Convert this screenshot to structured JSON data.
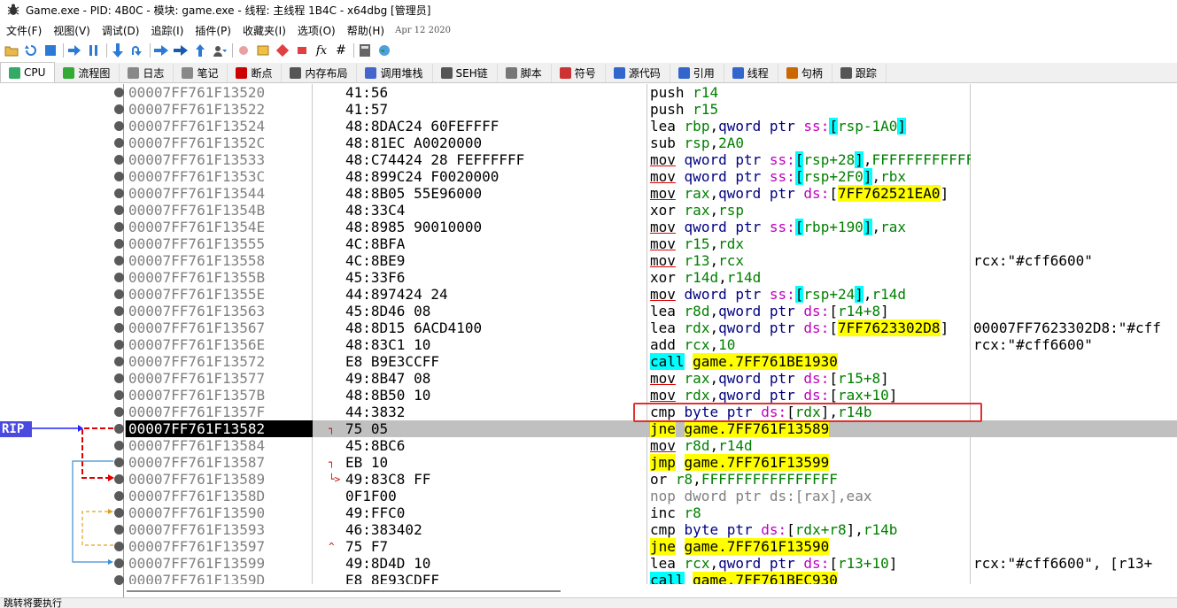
{
  "window": {
    "title": "Game.exe - PID: 4B0C - 模块: game.exe - 线程: 主线程 1B4C - x64dbg [管理员]",
    "app_icon": "x64dbg-bug-icon"
  },
  "menu": {
    "items": [
      "文件(F)",
      "视图(V)",
      "调试(D)",
      "追踪(I)",
      "插件(P)",
      "收藏夹(I)",
      "选项(O)",
      "帮助(H)"
    ],
    "date": "Apr 12 2020"
  },
  "toolbar": {
    "icons": [
      "open-icon",
      "restart-icon",
      "stop-icon",
      "run-icon",
      "pause-icon",
      "step-into-icon",
      "step-over-icon",
      "trace-into-icon",
      "trace-over-icon",
      "execute-till-return-icon",
      "run-to-user-code-icon",
      "scylla-icon",
      "patches-icon",
      "comments-icon",
      "labels-icon",
      "bookmarks-icon",
      "functions-icon",
      "variables-icon",
      "calculator-icon",
      "globe-icon"
    ]
  },
  "tabs": [
    {
      "label": "CPU",
      "icon": "cpu-icon",
      "active": true
    },
    {
      "label": "流程图",
      "icon": "graph-icon"
    },
    {
      "label": "日志",
      "icon": "log-icon"
    },
    {
      "label": "笔记",
      "icon": "notes-icon"
    },
    {
      "label": "断点",
      "icon": "breakpoint-icon"
    },
    {
      "label": "内存布局",
      "icon": "memory-icon"
    },
    {
      "label": "调用堆栈",
      "icon": "callstack-icon"
    },
    {
      "label": "SEH链",
      "icon": "seh-icon"
    },
    {
      "label": "脚本",
      "icon": "script-icon"
    },
    {
      "label": "符号",
      "icon": "symbols-icon"
    },
    {
      "label": "源代码",
      "icon": "source-icon"
    },
    {
      "label": "引用",
      "icon": "references-icon"
    },
    {
      "label": "线程",
      "icon": "threads-icon"
    },
    {
      "label": "句柄",
      "icon": "handles-icon"
    },
    {
      "label": "跟踪",
      "icon": "trace-icon"
    }
  ],
  "rip_label": "RIP",
  "status": "跳转将要执行",
  "rows": [
    {
      "addr": "00007FF761F13520",
      "bytes": "41:56",
      "arrow": "",
      "instr": [
        [
          "mn",
          "push"
        ],
        [
          "p",
          " "
        ],
        [
          "reg",
          "r14"
        ]
      ],
      "comment": ""
    },
    {
      "addr": "00007FF761F13522",
      "bytes": "41:57",
      "arrow": "",
      "instr": [
        [
          "mn",
          "push"
        ],
        [
          "p",
          " "
        ],
        [
          "reg",
          "r15"
        ]
      ],
      "comment": ""
    },
    {
      "addr": "00007FF761F13524",
      "bytes": "48:8DAC24 60FEFFFF",
      "arrow": "",
      "instr": [
        [
          "mn",
          "lea"
        ],
        [
          "p",
          " "
        ],
        [
          "reg",
          "rbp"
        ],
        [
          "p",
          ","
        ],
        [
          "sz",
          "qword ptr "
        ],
        [
          "seg",
          "ss:"
        ],
        [
          "brk",
          "["
        ],
        [
          "mem",
          "rsp-1A0"
        ],
        [
          "brk",
          "]"
        ]
      ],
      "comment": ""
    },
    {
      "addr": "00007FF761F1352C",
      "bytes": "48:81EC A0020000",
      "arrow": "",
      "instr": [
        [
          "mn",
          "sub"
        ],
        [
          "p",
          " "
        ],
        [
          "reg",
          "rsp"
        ],
        [
          "p",
          ","
        ],
        [
          "imm",
          "2A0"
        ]
      ],
      "comment": ""
    },
    {
      "addr": "00007FF761F13533",
      "bytes": "48:C74424 28 FEFFFFFF",
      "arrow": "",
      "instr": [
        [
          "mnmov",
          "mov"
        ],
        [
          "p",
          " "
        ],
        [
          "sz",
          "qword ptr "
        ],
        [
          "seg",
          "ss:"
        ],
        [
          "brk",
          "["
        ],
        [
          "mem",
          "rsp+28"
        ],
        [
          "brk",
          "]"
        ],
        [
          "p",
          ","
        ],
        [
          "imm",
          "FFFFFFFFFFFFFFFE"
        ]
      ],
      "comment": ""
    },
    {
      "addr": "00007FF761F1353C",
      "bytes": "48:899C24 F0020000",
      "arrow": "",
      "instr": [
        [
          "mnmov",
          "mov"
        ],
        [
          "p",
          " "
        ],
        [
          "sz",
          "qword ptr "
        ],
        [
          "seg",
          "ss:"
        ],
        [
          "brk",
          "["
        ],
        [
          "mem",
          "rsp+2F0"
        ],
        [
          "brk",
          "]"
        ],
        [
          "p",
          ","
        ],
        [
          "reg",
          "rbx"
        ]
      ],
      "comment": ""
    },
    {
      "addr": "00007FF761F13544",
      "bytes": "48:8B05 55E96000",
      "arrow": "",
      "instr": [
        [
          "mnmov",
          "mov"
        ],
        [
          "p",
          " "
        ],
        [
          "reg",
          "rax"
        ],
        [
          "p",
          ","
        ],
        [
          "sz",
          "qword ptr "
        ],
        [
          "seg",
          "ds:"
        ],
        [
          "p",
          "["
        ],
        [
          "memhl",
          "7FF762521EA0"
        ],
        [
          "p",
          "]"
        ]
      ],
      "comment": ""
    },
    {
      "addr": "00007FF761F1354B",
      "bytes": "48:33C4",
      "arrow": "",
      "instr": [
        [
          "mn",
          "xor"
        ],
        [
          "p",
          " "
        ],
        [
          "reg",
          "rax"
        ],
        [
          "p",
          ","
        ],
        [
          "reg",
          "rsp"
        ]
      ],
      "comment": ""
    },
    {
      "addr": "00007FF761F1354E",
      "bytes": "48:8985 90010000",
      "arrow": "",
      "instr": [
        [
          "mnmov",
          "mov"
        ],
        [
          "p",
          " "
        ],
        [
          "sz",
          "qword ptr "
        ],
        [
          "seg",
          "ss:"
        ],
        [
          "brk",
          "["
        ],
        [
          "mem",
          "rbp+190"
        ],
        [
          "brk",
          "]"
        ],
        [
          "p",
          ","
        ],
        [
          "reg",
          "rax"
        ]
      ],
      "comment": ""
    },
    {
      "addr": "00007FF761F13555",
      "bytes": "4C:8BFA",
      "arrow": "",
      "instr": [
        [
          "mnmov",
          "mov"
        ],
        [
          "p",
          " "
        ],
        [
          "reg",
          "r15"
        ],
        [
          "p",
          ","
        ],
        [
          "reg",
          "rdx"
        ]
      ],
      "comment": ""
    },
    {
      "addr": "00007FF761F13558",
      "bytes": "4C:8BE9",
      "arrow": "",
      "instr": [
        [
          "mnmov",
          "mov"
        ],
        [
          "p",
          " "
        ],
        [
          "reg",
          "r13"
        ],
        [
          "p",
          ","
        ],
        [
          "reg",
          "rcx"
        ]
      ],
      "comment": "rcx:\"#cff6600\""
    },
    {
      "addr": "00007FF761F1355B",
      "bytes": "45:33F6",
      "arrow": "",
      "instr": [
        [
          "mn",
          "xor"
        ],
        [
          "p",
          " "
        ],
        [
          "reg",
          "r14d"
        ],
        [
          "p",
          ","
        ],
        [
          "reg",
          "r14d"
        ]
      ],
      "comment": ""
    },
    {
      "addr": "00007FF761F1355E",
      "bytes": "44:897424 24",
      "arrow": "",
      "instr": [
        [
          "mnmov",
          "mov"
        ],
        [
          "p",
          " "
        ],
        [
          "sz",
          "dword ptr "
        ],
        [
          "seg",
          "ss:"
        ],
        [
          "brk",
          "["
        ],
        [
          "mem",
          "rsp+24"
        ],
        [
          "brk",
          "]"
        ],
        [
          "p",
          ","
        ],
        [
          "reg",
          "r14d"
        ]
      ],
      "comment": ""
    },
    {
      "addr": "00007FF761F13563",
      "bytes": "45:8D46 08",
      "arrow": "",
      "instr": [
        [
          "mn",
          "lea"
        ],
        [
          "p",
          " "
        ],
        [
          "reg",
          "r8d"
        ],
        [
          "p",
          ","
        ],
        [
          "sz",
          "qword ptr "
        ],
        [
          "seg",
          "ds:"
        ],
        [
          "p",
          "["
        ],
        [
          "mem",
          "r14+8"
        ],
        [
          "p",
          "]"
        ]
      ],
      "comment": ""
    },
    {
      "addr": "00007FF761F13567",
      "bytes": "48:8D15 6ACD4100",
      "arrow": "",
      "instr": [
        [
          "mn",
          "lea"
        ],
        [
          "p",
          " "
        ],
        [
          "reg",
          "rdx"
        ],
        [
          "p",
          ","
        ],
        [
          "sz",
          "qword ptr "
        ],
        [
          "seg",
          "ds:"
        ],
        [
          "p",
          "["
        ],
        [
          "memhl",
          "7FF7623302D8"
        ],
        [
          "p",
          "]"
        ]
      ],
      "comment": "00007FF7623302D8:\"#cff"
    },
    {
      "addr": "00007FF761F1356E",
      "bytes": "48:83C1 10",
      "arrow": "",
      "instr": [
        [
          "mn",
          "add"
        ],
        [
          "p",
          " "
        ],
        [
          "reg",
          "rcx"
        ],
        [
          "p",
          ","
        ],
        [
          "imm",
          "10"
        ]
      ],
      "comment": "rcx:\"#cff6600\""
    },
    {
      "addr": "00007FF761F13572",
      "bytes": "E8 B9E3CCFF",
      "arrow": "",
      "instr": [
        [
          "call",
          "call"
        ],
        [
          "p",
          " "
        ],
        [
          "tgt",
          "game.7FF761BE1930"
        ]
      ],
      "comment": ""
    },
    {
      "addr": "00007FF761F13577",
      "bytes": "49:8B47 08",
      "arrow": "",
      "instr": [
        [
          "mnmov",
          "mov"
        ],
        [
          "p",
          " "
        ],
        [
          "reg",
          "rax"
        ],
        [
          "p",
          ","
        ],
        [
          "sz",
          "qword ptr "
        ],
        [
          "seg",
          "ds:"
        ],
        [
          "p",
          "["
        ],
        [
          "mem",
          "r15+8"
        ],
        [
          "p",
          "]"
        ]
      ],
      "comment": ""
    },
    {
      "addr": "00007FF761F1357B",
      "bytes": "48:8B50 10",
      "arrow": "",
      "instr": [
        [
          "mnmov",
          "mov"
        ],
        [
          "p",
          " "
        ],
        [
          "reg",
          "rdx"
        ],
        [
          "p",
          ","
        ],
        [
          "sz",
          "qword ptr "
        ],
        [
          "seg",
          "ds:"
        ],
        [
          "p",
          "["
        ],
        [
          "mem",
          "rax+10"
        ],
        [
          "p",
          "]"
        ]
      ],
      "comment": ""
    },
    {
      "addr": "00007FF761F1357F",
      "bytes": "44:3832",
      "arrow": "",
      "instr": [
        [
          "mn",
          "cmp"
        ],
        [
          "p",
          " "
        ],
        [
          "sz",
          "byte ptr "
        ],
        [
          "seg",
          "ds:"
        ],
        [
          "p",
          "["
        ],
        [
          "mem",
          "rdx"
        ],
        [
          "p",
          "]"
        ],
        [
          "p",
          ","
        ],
        [
          "reg",
          "r14b"
        ]
      ],
      "comment": ""
    },
    {
      "addr": "00007FF761F13582",
      "bytes": "75 05",
      "arrow": "┐",
      "instr": [
        [
          "jcc",
          "jne"
        ],
        [
          "p",
          " "
        ],
        [
          "tgt",
          "game.7FF761F13589"
        ]
      ],
      "comment": "",
      "current": true
    },
    {
      "addr": "00007FF761F13584",
      "bytes": "45:8BC6",
      "arrow": "",
      "instr": [
        [
          "mnmov",
          "mov"
        ],
        [
          "p",
          " "
        ],
        [
          "reg",
          "r8d"
        ],
        [
          "p",
          ","
        ],
        [
          "reg",
          "r14d"
        ]
      ],
      "comment": ""
    },
    {
      "addr": "00007FF761F13587",
      "bytes": "EB 10",
      "arrow": "┐",
      "instr": [
        [
          "jmp",
          "jmp"
        ],
        [
          "p",
          " "
        ],
        [
          "tgt",
          "game.7FF761F13599"
        ]
      ],
      "comment": ""
    },
    {
      "addr": "00007FF761F13589",
      "bytes": "49:83C8 FF",
      "arrow": "└>",
      "instr": [
        [
          "mn",
          "or"
        ],
        [
          "p",
          " "
        ],
        [
          "reg",
          "r8"
        ],
        [
          "p",
          ","
        ],
        [
          "imm",
          "FFFFFFFFFFFFFFFF"
        ]
      ],
      "comment": ""
    },
    {
      "addr": "00007FF761F1358D",
      "bytes": "0F1F00",
      "arrow": "",
      "instr": [
        [
          "nop",
          "nop dword ptr ds:[rax],eax"
        ]
      ],
      "comment": ""
    },
    {
      "addr": "00007FF761F13590",
      "bytes": "49:FFC0",
      "arrow": "",
      "instr": [
        [
          "mn",
          "inc"
        ],
        [
          "p",
          " "
        ],
        [
          "reg",
          "r8"
        ]
      ],
      "comment": ""
    },
    {
      "addr": "00007FF761F13593",
      "bytes": "46:383402",
      "arrow": "",
      "instr": [
        [
          "mn",
          "cmp"
        ],
        [
          "p",
          " "
        ],
        [
          "sz",
          "byte ptr "
        ],
        [
          "seg",
          "ds:"
        ],
        [
          "p",
          "["
        ],
        [
          "mem",
          "rdx+r8"
        ],
        [
          "p",
          "]"
        ],
        [
          "p",
          ","
        ],
        [
          "reg",
          "r14b"
        ]
      ],
      "comment": ""
    },
    {
      "addr": "00007FF761F13597",
      "bytes": "75 F7",
      "arrow": "^",
      "instr": [
        [
          "jcc",
          "jne"
        ],
        [
          "p",
          " "
        ],
        [
          "tgt",
          "game.7FF761F13590"
        ]
      ],
      "comment": ""
    },
    {
      "addr": "00007FF761F13599",
      "bytes": "49:8D4D 10",
      "arrow": "",
      "instr": [
        [
          "mn",
          "lea"
        ],
        [
          "p",
          " "
        ],
        [
          "reg",
          "rcx"
        ],
        [
          "p",
          ","
        ],
        [
          "sz",
          "qword ptr "
        ],
        [
          "seg",
          "ds:"
        ],
        [
          "p",
          "["
        ],
        [
          "mem",
          "r13+10"
        ],
        [
          "p",
          "]"
        ]
      ],
      "comment": "rcx:\"#cff6600\", [r13+"
    },
    {
      "addr": "00007FF761F1359D",
      "bytes": "E8 8E93CDFF",
      "arrow": "",
      "instr": [
        [
          "call",
          "call"
        ],
        [
          "p",
          " "
        ],
        [
          "tgt",
          "game.7FF761BEC930"
        ]
      ],
      "comment": ""
    }
  ]
}
